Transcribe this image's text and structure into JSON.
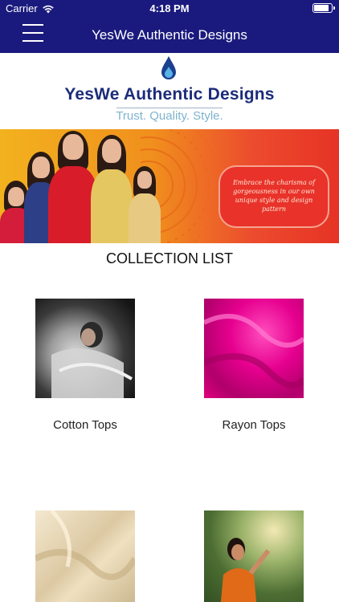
{
  "status_bar": {
    "carrier": "Carrier",
    "time": "4:18 PM",
    "battery_level": 0.95,
    "wifi_icon": "wifi-icon",
    "battery_icon": "battery-icon"
  },
  "nav": {
    "title": "YesWe Authentic Designs",
    "menu_icon": "hamburger-menu-icon"
  },
  "logo": {
    "brand_name": "YesWe Authentic Designs",
    "tagline": "Trust. Quality. Style.",
    "icon": "water-drop-icon",
    "colors": {
      "brand": "#1c2c7a",
      "tagline": "#7fb3cf",
      "drop": "#2f8fc8"
    }
  },
  "banner": {
    "text": "Embrace the charisma of gorgeousness in our own unique style and design pattern"
  },
  "collection": {
    "title": "COLLECTION LIST",
    "items": [
      {
        "label": "Cotton Tops"
      },
      {
        "label": "Rayon Tops"
      },
      {
        "label": ""
      },
      {
        "label": ""
      }
    ]
  },
  "colors": {
    "nav_bg": "#1a1a7e",
    "banner_start": "#f2b21e",
    "banner_end": "#e63325"
  }
}
